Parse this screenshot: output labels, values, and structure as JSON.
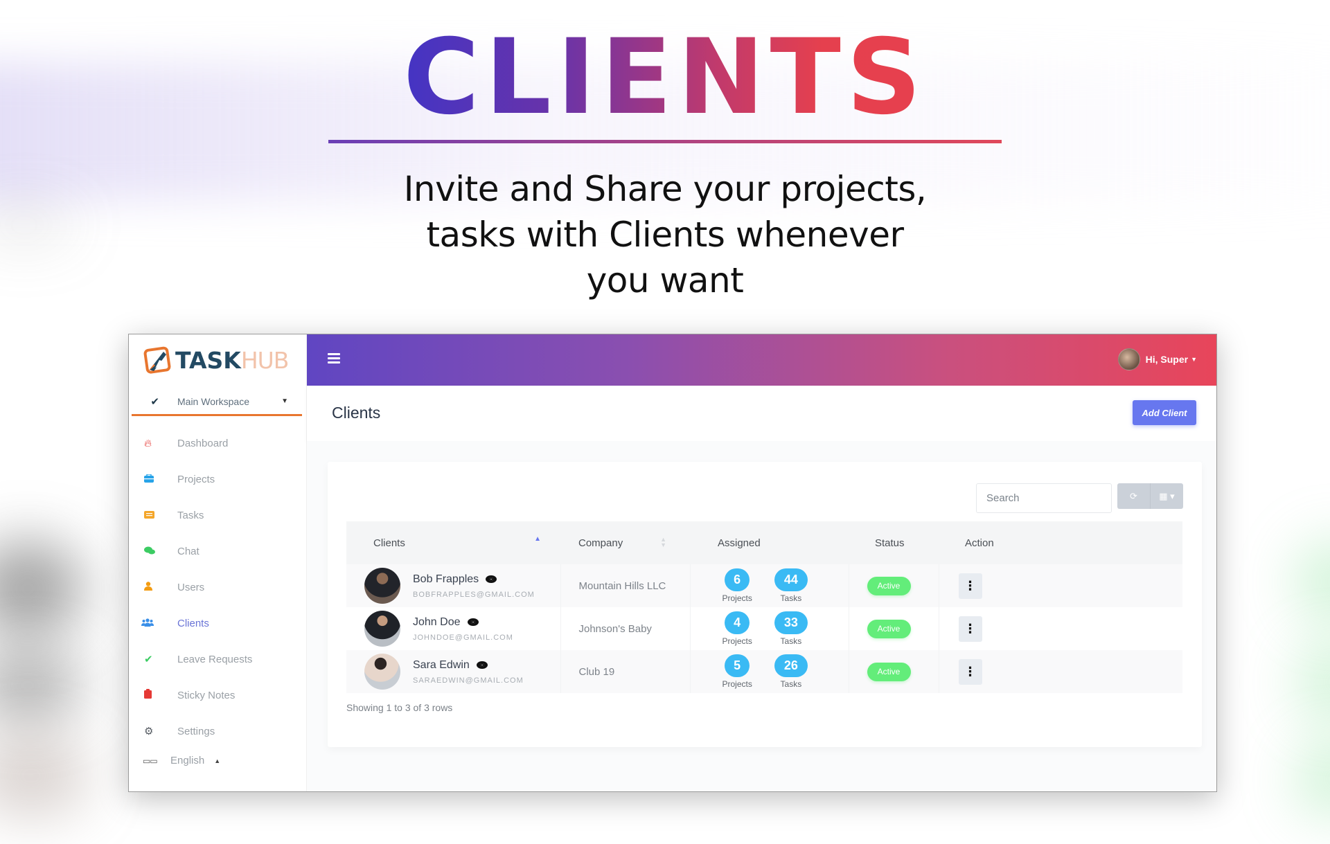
{
  "hero": {
    "title": "CLIENTS",
    "subtitle": "Invite and Share your projects,\ntasks  with Clients whenever\nyou want"
  },
  "app": {
    "logo": {
      "part1": "TASK",
      "part2": "HUB"
    },
    "workspace": {
      "label": "Main Workspace"
    },
    "nav": [
      {
        "label": "Dashboard",
        "icon": "fire-icon",
        "color": "#e53935"
      },
      {
        "label": "Projects",
        "icon": "briefcase-icon",
        "color": "#27a3e8"
      },
      {
        "label": "Tasks",
        "icon": "newspaper-icon",
        "color": "#f4a62a"
      },
      {
        "label": "Chat",
        "icon": "chat-bubbles-icon",
        "color": "#3ccc63"
      },
      {
        "label": "Users",
        "icon": "user-icon",
        "color": "#f39c12"
      },
      {
        "label": "Clients",
        "icon": "users-group-icon",
        "color": "#3a8fe8",
        "active": true
      },
      {
        "label": "Leave Requests",
        "icon": "check-icon",
        "color": "#3ccc63"
      },
      {
        "label": "Sticky Notes",
        "icon": "clipboard-icon",
        "color": "#e53935"
      },
      {
        "label": "Settings",
        "icon": "gear-icon",
        "color": "#555b62"
      }
    ],
    "language": {
      "label": "English"
    },
    "topbar": {
      "user_greeting": "Hi, Super"
    },
    "page": {
      "title": "Clients",
      "add_button": "Add Client"
    },
    "search": {
      "placeholder": "Search"
    },
    "table": {
      "columns": [
        "Clients",
        "Company",
        "Assigned",
        "Status",
        "Action"
      ],
      "rows": [
        {
          "name": "Bob Frapples",
          "email": "BOBFRAPPLES@GMAIL.COM",
          "company": "Mountain Hills LLC",
          "projects": "6",
          "tasks": "44",
          "status": "Active"
        },
        {
          "name": "John Doe",
          "email": "JOHNDOE@GMAIL.COM",
          "company": "Johnson's Baby",
          "projects": "4",
          "tasks": "33",
          "status": "Active"
        },
        {
          "name": "Sara Edwin",
          "email": "SARAEDWIN@GMAIL.COM",
          "company": "Club 19",
          "projects": "5",
          "tasks": "26",
          "status": "Active"
        }
      ],
      "projects_label": "Projects",
      "tasks_label": "Tasks"
    },
    "pagination_text": "Showing 1 to 3 of 3 rows",
    "colors": {
      "accent": "#6777ef",
      "pill": "#3abaf4",
      "active_badge": "#63ed7a",
      "workspace_underline": "#e8762f",
      "header_gradient_start": "#6046c2",
      "header_gradient_end": "#e8455a"
    }
  }
}
